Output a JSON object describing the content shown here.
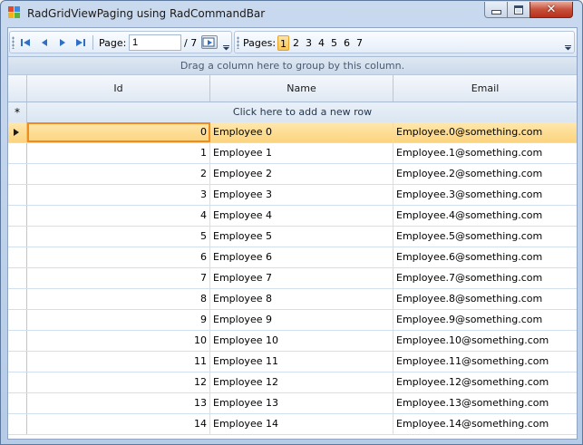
{
  "window": {
    "title": "RadGridViewPaging using RadCommandBar"
  },
  "pager": {
    "page_label": "Page:",
    "page_value": "1",
    "page_total": "/ 7",
    "pages_label": "Pages:",
    "pages": [
      "1",
      "2",
      "3",
      "4",
      "5",
      "6",
      "7"
    ],
    "selected_page": "1"
  },
  "grid": {
    "group_hint": "Drag a column here to group by this column.",
    "new_row_hint": "Click here to add a new row",
    "new_row_symbol": "*",
    "columns": [
      "Id",
      "Name",
      "Email"
    ],
    "rows": [
      {
        "id": "0",
        "name": "Employee 0",
        "email": "Employee.0@something.com"
      },
      {
        "id": "1",
        "name": "Employee 1",
        "email": "Employee.1@something.com"
      },
      {
        "id": "2",
        "name": "Employee 2",
        "email": "Employee.2@something.com"
      },
      {
        "id": "3",
        "name": "Employee 3",
        "email": "Employee.3@something.com"
      },
      {
        "id": "4",
        "name": "Employee 4",
        "email": "Employee.4@something.com"
      },
      {
        "id": "5",
        "name": "Employee 5",
        "email": "Employee.5@something.com"
      },
      {
        "id": "6",
        "name": "Employee 6",
        "email": "Employee.6@something.com"
      },
      {
        "id": "7",
        "name": "Employee 7",
        "email": "Employee.7@something.com"
      },
      {
        "id": "8",
        "name": "Employee 8",
        "email": "Employee.8@something.com"
      },
      {
        "id": "9",
        "name": "Employee 9",
        "email": "Employee.9@something.com"
      },
      {
        "id": "10",
        "name": "Employee 10",
        "email": "Employee.10@something.com"
      },
      {
        "id": "11",
        "name": "Employee 11",
        "email": "Employee.11@something.com"
      },
      {
        "id": "12",
        "name": "Employee 12",
        "email": "Employee.12@something.com"
      },
      {
        "id": "13",
        "name": "Employee 13",
        "email": "Employee.13@something.com"
      },
      {
        "id": "14",
        "name": "Employee 14",
        "email": "Employee.14@something.com"
      }
    ],
    "current_row": 0
  },
  "colors": {
    "accent": "#f7c45a",
    "selection_border": "#f08b1e",
    "header": "#dfe8f3",
    "nav_blue": "#2f6fc4"
  }
}
